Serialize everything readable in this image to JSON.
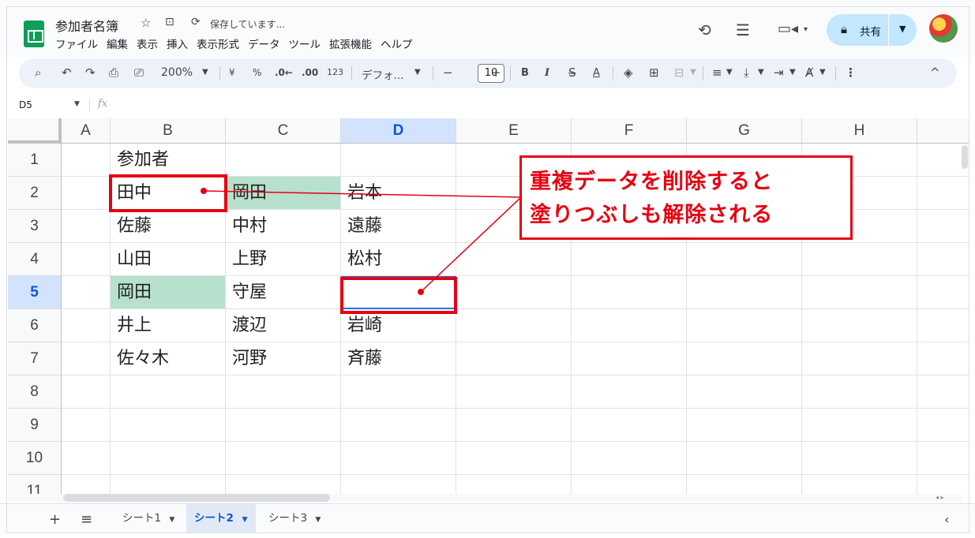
{
  "app": {
    "doc_title": "参加者名簿",
    "saving_status": "保存しています...",
    "menu": [
      "ファイル",
      "編集",
      "表示",
      "挿入",
      "表示形式",
      "データ",
      "ツール",
      "拡張機能",
      "ヘルプ"
    ],
    "share_label": "共有"
  },
  "toolbar": {
    "zoom": "200%",
    "currency": "¥",
    "percent": "%",
    "dec_decrease": ".0←",
    "dec_increase": ".00",
    "format_123": "123",
    "font": "デフォ...",
    "minus": "−",
    "font_size": "10",
    "plus": "+",
    "bold": "B",
    "italic": "I",
    "text_color": "A",
    "more": "⋮",
    "collapse": "^"
  },
  "formula_bar": {
    "name_box": "D5",
    "fx": "fx"
  },
  "grid": {
    "columns": [
      "A",
      "B",
      "C",
      "D",
      "E",
      "F",
      "G",
      "H"
    ],
    "selected_column": "D",
    "rows": [
      "1",
      "2",
      "3",
      "4",
      "5",
      "6",
      "7",
      "8",
      "9",
      "10",
      "11"
    ],
    "selected_row": "5",
    "cells": {
      "B1": "参加者",
      "B2": "田中",
      "C2": "岡田",
      "D2": "岩本",
      "B3": "佐藤",
      "C3": "中村",
      "D3": "遠藤",
      "B4": "山田",
      "C4": "上野",
      "D4": "松村",
      "B5": "岡田",
      "C5": "守屋",
      "D5": "",
      "B6": "井上",
      "C6": "渡辺",
      "D6": "岩崎",
      "B7": "佐々木",
      "C7": "河野",
      "D7": "斉藤"
    },
    "highlight_color": "#b7e1cd",
    "highlighted_cells": [
      "C2",
      "B5"
    ]
  },
  "annotation": {
    "line1": "重複データを削除すると",
    "line2": "塗りつぶしも解除される",
    "color": "#e60012"
  },
  "sheets": {
    "tabs": [
      "シート1",
      "シート2",
      "シート3"
    ],
    "active": "シート2"
  }
}
